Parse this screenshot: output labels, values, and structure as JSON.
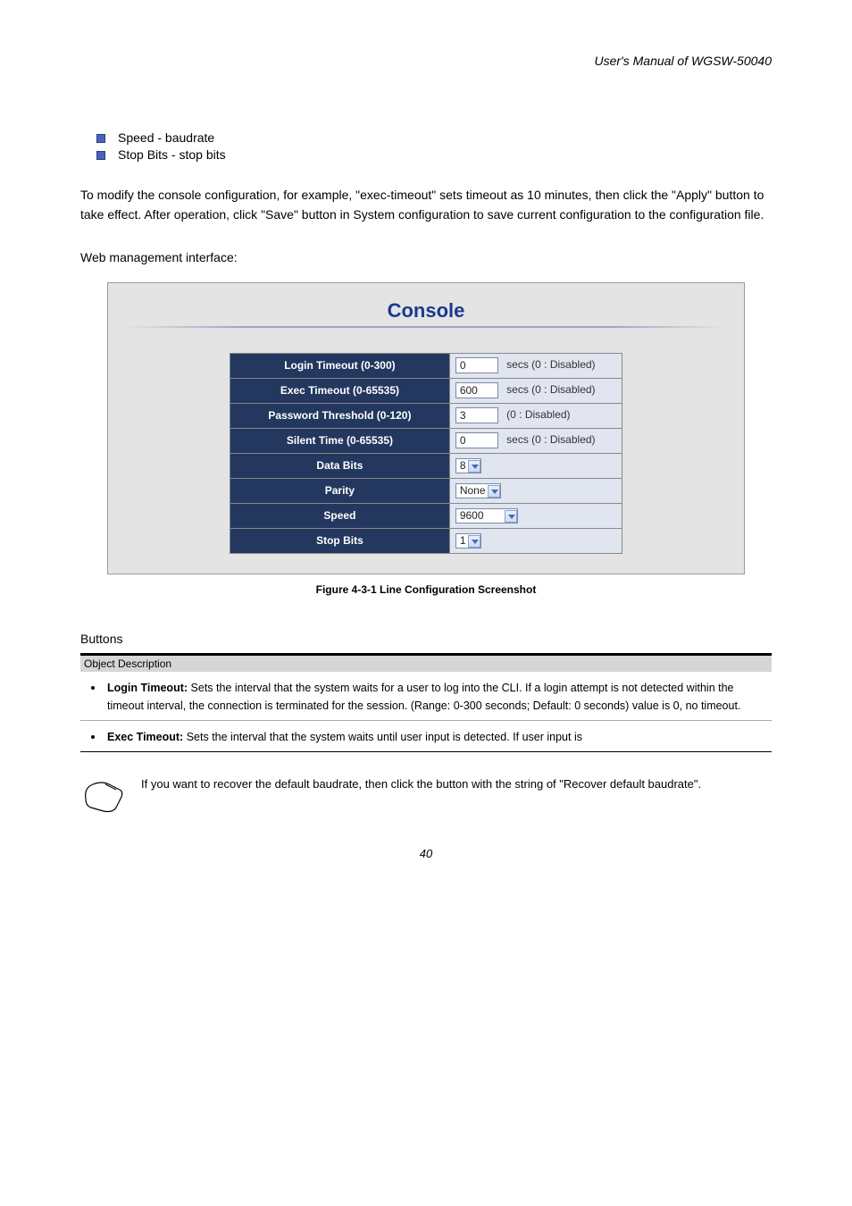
{
  "header": {
    "manual_title": "User's Manual of WGSW-50040"
  },
  "section": {
    "labels": {
      "speed_line": "Speed - baudrate",
      "stopbits_line": "Stop Bits - stop bits"
    },
    "intro": "To modify the console configuration, for example, \"exec-timeout\" sets timeout as 10 minutes, then click the \"Apply\" button to take effect. After operation, click \"Save\" button in System configuration  to save current configuration to the configuration file.",
    "web_line": "Web management interface:"
  },
  "console_panel": {
    "title": "Console",
    "rows": {
      "login_timeout_label": "Login Timeout (0-300)",
      "login_timeout_value": "0",
      "login_timeout_suffix": "secs (0 : Disabled)",
      "exec_timeout_label": "Exec Timeout (0-65535)",
      "exec_timeout_value": "600",
      "exec_timeout_suffix": "secs (0 : Disabled)",
      "pw_threshold_label": "Password Threshold (0-120)",
      "pw_threshold_value": "3",
      "pw_threshold_suffix": "(0 : Disabled)",
      "silent_time_label": "Silent Time (0-65535)",
      "silent_time_value": "0",
      "silent_time_suffix": "secs (0 : Disabled)",
      "data_bits_label": "Data Bits",
      "data_bits_value": "8",
      "parity_label": "Parity",
      "parity_value": "None",
      "speed_label": "Speed",
      "speed_value": "9600",
      "stop_bits_label": "Stop Bits",
      "stop_bits_value": "1"
    }
  },
  "figure_caption": "Figure 4-3-1 Line Configuration Screenshot",
  "buttons_section": {
    "title": "Buttons",
    "header": "Object                                   Description",
    "items": [
      {
        "lead": "Login Timeout:",
        "body": "Sets the interval that the system waits for a user to log into the CLI. If a login attempt is not detected within the timeout interval, the connection is terminated for the session. (Range: 0-300 seconds; Default: 0 seconds) value is 0, no timeout."
      },
      {
        "lead": "Exec Timeout:",
        "body": "Sets the interval that the system waits until user input is detected. If user input is"
      }
    ]
  },
  "tip": {
    "text": "If you want to recover the default baudrate, then click the button with the string of \"Recover default baudrate\"."
  },
  "footer": {
    "page": "40"
  }
}
